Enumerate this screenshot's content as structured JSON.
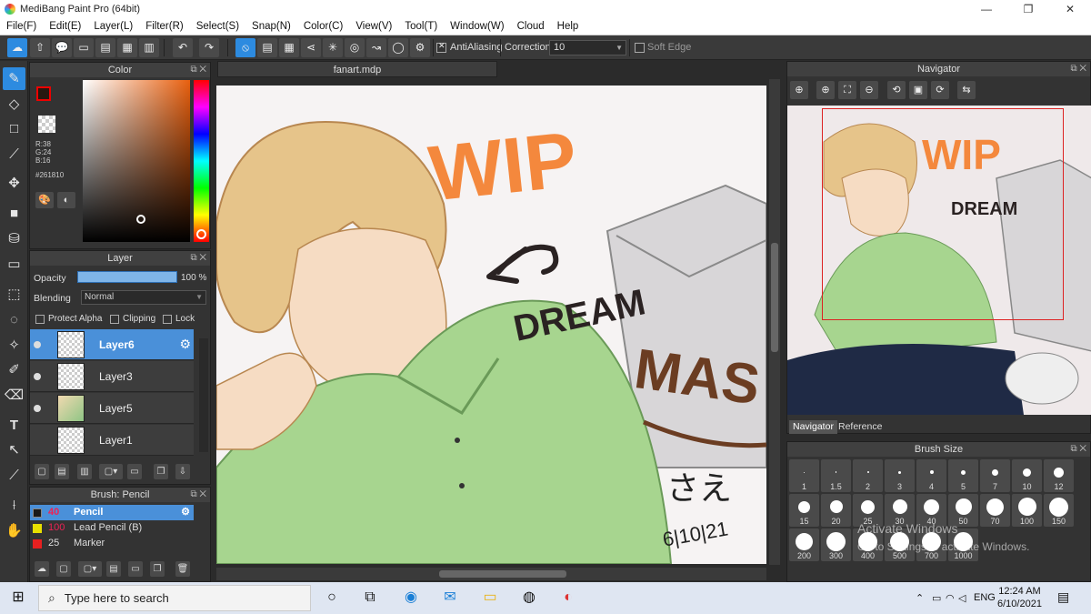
{
  "window": {
    "title": "MediBang Paint Pro (64bit)",
    "buttons": [
      "—",
      "❐",
      "✕"
    ]
  },
  "menu": [
    "File(F)",
    "Edit(E)",
    "Layer(L)",
    "Filter(R)",
    "Select(S)",
    "Snap(N)",
    "Color(C)",
    "View(V)",
    "Tool(T)",
    "Window(W)",
    "Cloud",
    "Help"
  ],
  "toolbar": {
    "antialiasing_label": "AntiAliasing",
    "correction_label": "Correction",
    "correction_value": "10",
    "softedge_label": "Soft Edge"
  },
  "color_panel": {
    "title": "Color",
    "r": "R:38",
    "g": "G:24",
    "b": "B:16",
    "hex": "#261810",
    "fg_color": "#261810"
  },
  "layer_panel": {
    "title": "Layer",
    "opacity_label": "Opacity",
    "opacity_value": "100 %",
    "opacity_fraction": 1.0,
    "blending_label": "Blending",
    "blending_value": "Normal",
    "protect_alpha": "Protect Alpha",
    "clipping": "Clipping",
    "lock": "Lock",
    "layers": [
      {
        "name": "Layer6",
        "selected": true
      },
      {
        "name": "Layer3",
        "selected": false
      },
      {
        "name": "Layer5",
        "selected": false
      },
      {
        "name": "Layer1",
        "selected": false
      }
    ]
  },
  "brush_panel": {
    "title": "Brush: Pencil",
    "brushes": [
      {
        "size": "40",
        "name": "Pencil",
        "color": "#1a1a1a",
        "selected": true
      },
      {
        "size": "100",
        "name": "Lead Pencil (B)",
        "color": "#e8e000",
        "selected": false
      },
      {
        "size": "25",
        "name": "Marker",
        "color": "#e82020",
        "selected": false
      }
    ]
  },
  "canvas": {
    "tab": "fanart.mdp",
    "art_text": {
      "wip": "WIP",
      "dream": "DREAM",
      "mask": "MAS",
      "signature": "さえ",
      "date": "6|10|21"
    }
  },
  "navigator": {
    "title": "Navigator",
    "tabs": [
      "Navigator",
      "Reference"
    ]
  },
  "brush_size": {
    "title": "Brush Size",
    "sizes": [
      "1",
      "1.5",
      "2",
      "3",
      "4",
      "5",
      "7",
      "10",
      "12",
      "15",
      "20",
      "25",
      "30",
      "40",
      "50",
      "70",
      "100",
      "150",
      "200",
      "300",
      "400",
      "500",
      "700",
      "1000"
    ]
  },
  "watermark": {
    "line1": "Activate Windows",
    "line2": "Go to Settings to activate Windows."
  },
  "taskbar": {
    "search_placeholder": "Type here to search",
    "lang": "ENG",
    "time": "12:24 AM",
    "date": "6/10/2021"
  }
}
